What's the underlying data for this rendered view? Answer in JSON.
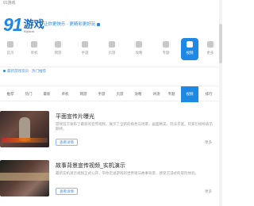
{
  "topbar": {
    "text": "91游戏"
  },
  "brand": {
    "logo_number": "91",
    "logo_text": "游戏",
    "logo_sub": "91youxi",
    "slogan": "让你更快乐 · 更精彩更好玩"
  },
  "nav": {
    "items": [
      {
        "label": "首页",
        "icon": "home-icon"
      },
      {
        "label": "单机",
        "icon": "disc-icon"
      },
      {
        "label": "网游",
        "icon": "globe-icon"
      },
      {
        "label": "手游",
        "icon": "phone-icon"
      },
      {
        "label": "页游",
        "icon": "browser-icon"
      },
      {
        "label": "攻略",
        "icon": "book-icon"
      },
      {
        "label": "专题",
        "icon": "star-icon"
      },
      {
        "label": "视频",
        "icon": "video-icon"
      },
      {
        "label": "更多",
        "icon": "more-icon"
      }
    ],
    "active_index": 7
  },
  "notice": {
    "text": "最新游戏资讯 · 热门推荐"
  },
  "tabs": {
    "items": [
      "推荐",
      "热门",
      "最新",
      "单机",
      "网游",
      "手游",
      "页游",
      "攻略",
      "评测",
      "视频",
      "专题",
      "排行"
    ],
    "active_index": 9
  },
  "cards": [
    {
      "title": "平面宣传片曝光",
      "desc": "游戏官方发布了最新的宣传视频，展示了全新的角色与场景，画面精美，玩法丰富，玩家们纷纷表示期待。",
      "button": "查看详情",
      "more": "更多"
    },
    {
      "title": "故事背景宣传视频_实机演示",
      "desc": "最新实机演示视频正式公开，带你走进游戏的世界观与故事背景，感受沉浸式的冒险体验。",
      "button": "查看详情",
      "more": "更多"
    }
  ],
  "colors": {
    "accent": "#1e88e5"
  }
}
